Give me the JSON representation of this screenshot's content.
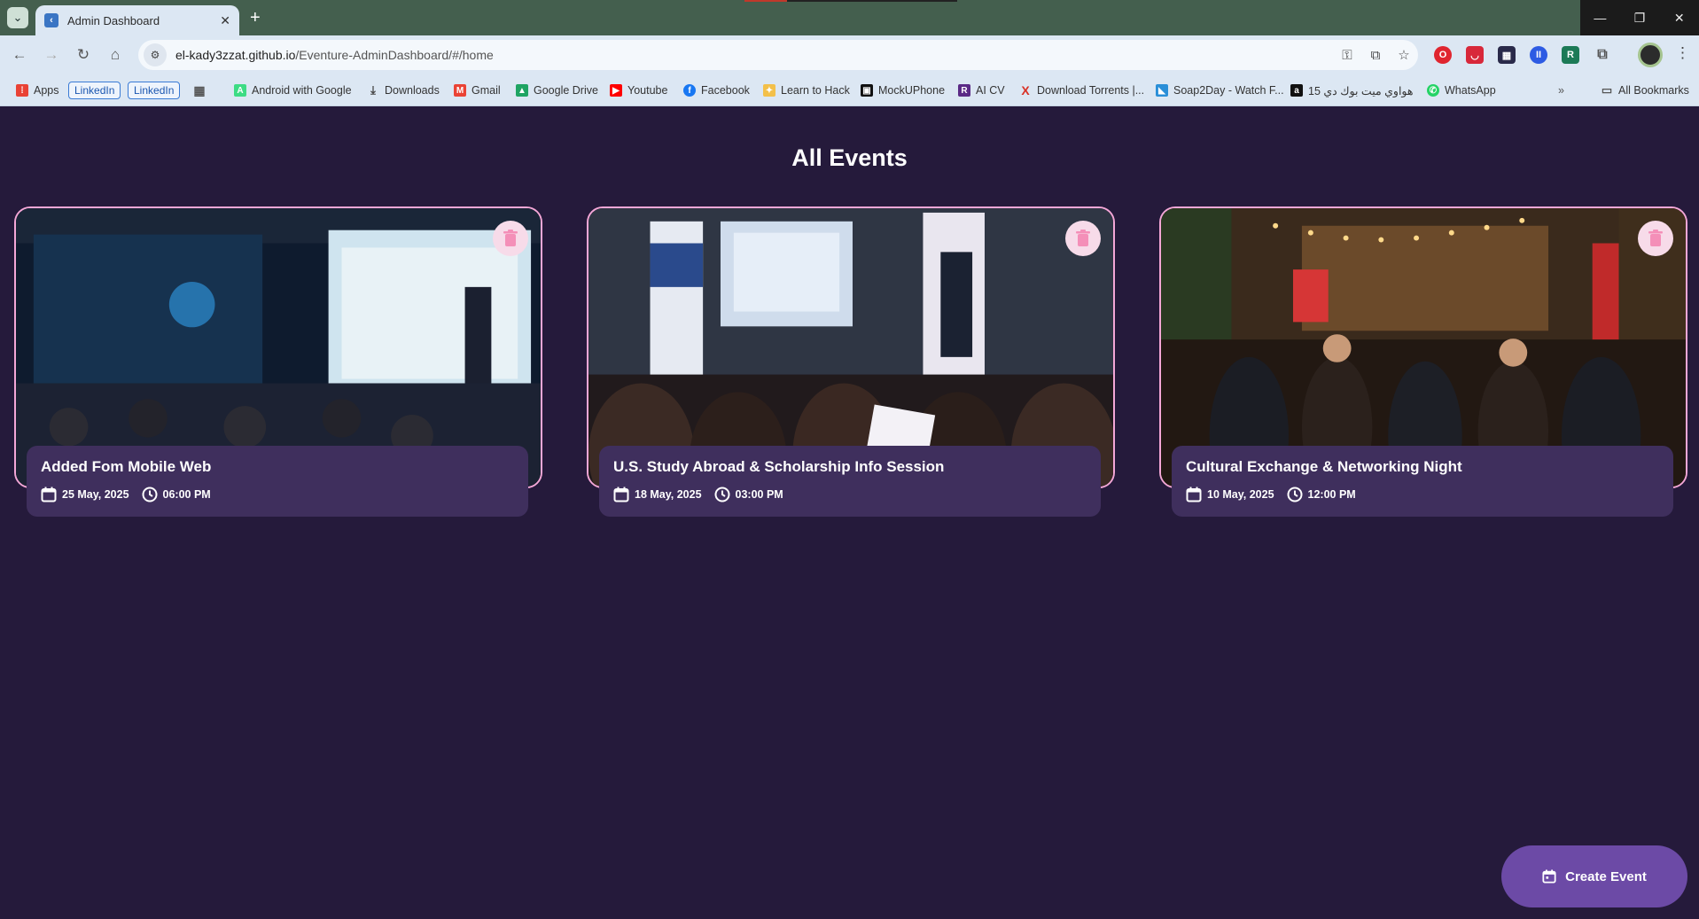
{
  "browser": {
    "tab_title": "Admin Dashboard",
    "url_host": "el-kady3zzat.github.io",
    "url_path": "/Eventure-AdminDashboard/#/home",
    "bookmarks": [
      {
        "label": "Apps"
      },
      {
        "label": "LinkedIn"
      },
      {
        "label": "LinkedIn"
      },
      {
        "label": "Android with Google"
      },
      {
        "label": "Downloads"
      },
      {
        "label": "Gmail"
      },
      {
        "label": "Google Drive"
      },
      {
        "label": "Youtube"
      },
      {
        "label": "Facebook"
      },
      {
        "label": "Learn to Hack"
      },
      {
        "label": "MockUPhone"
      },
      {
        "label": "AI CV"
      },
      {
        "label": "Download Torrents |..."
      },
      {
        "label": "Soap2Day - Watch F..."
      },
      {
        "label": "هواوي ميت بوك دي 15"
      },
      {
        "label": "WhatsApp"
      }
    ],
    "all_bookmarks": "All Bookmarks"
  },
  "page": {
    "heading": "All Events",
    "create_button": "Create Event"
  },
  "events": [
    {
      "title": "Added Fom Mobile Web",
      "date": "25 May, 2025",
      "time": "06:00 PM"
    },
    {
      "title": "U.S. Study Abroad & Scholarship Info Session",
      "date": "18 May, 2025",
      "time": "03:00 PM"
    },
    {
      "title": "Cultural Exchange & Networking Night",
      "date": "10 May, 2025",
      "time": "12:00 PM"
    }
  ],
  "colors": {
    "background": "#251a3b",
    "card_border": "#f4a7d7",
    "card_info": "#3f2f5d",
    "fab": "#6c4aa6",
    "delete_icon": "#f48fb8"
  }
}
